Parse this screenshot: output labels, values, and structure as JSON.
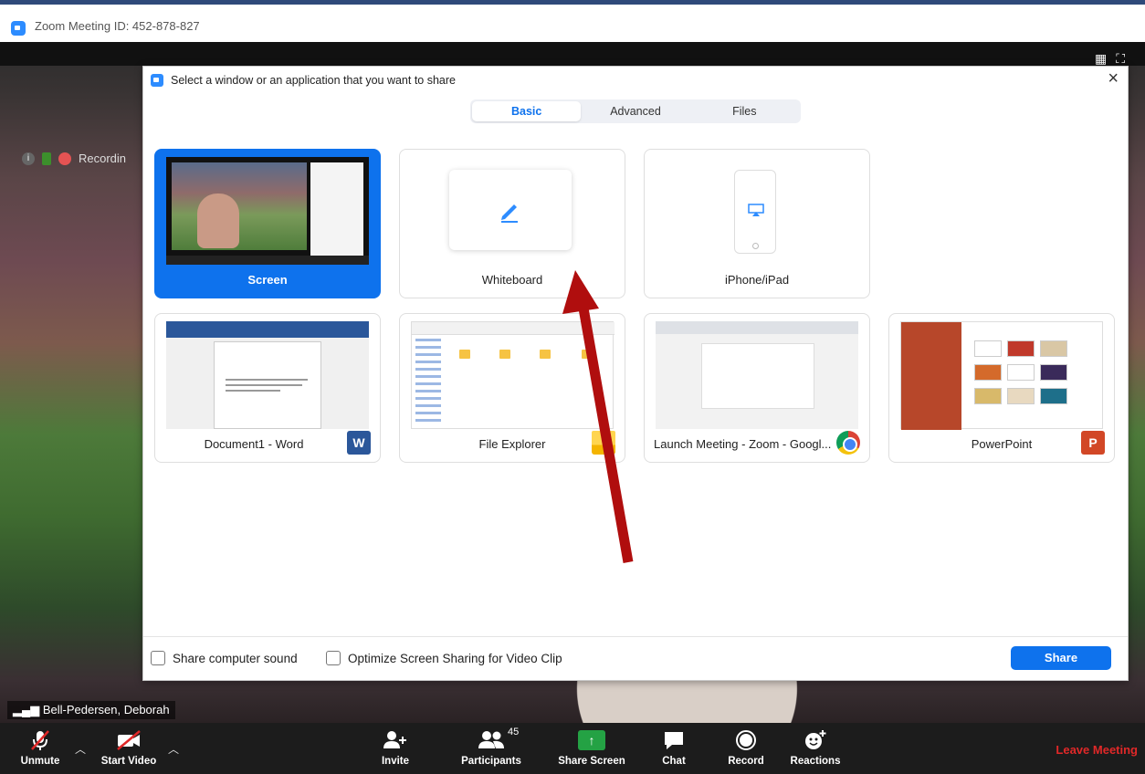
{
  "window": {
    "title": "Zoom Meeting ID: 452-878-827"
  },
  "video": {
    "recording_label": "Recordin",
    "speaker_name": "Bell-Pedersen, Deborah"
  },
  "dialog": {
    "title": "Select a window or an application that you want to share",
    "close_label": "×",
    "tabs": [
      "Basic",
      "Advanced",
      "Files"
    ],
    "active_tab": "Basic",
    "tiles": [
      {
        "label": "Screen",
        "selected": true
      },
      {
        "label": "Whiteboard"
      },
      {
        "label": "iPhone/iPad"
      },
      {
        "label": "Document1 - Word",
        "icon": "word-icon"
      },
      {
        "label": "File Explorer",
        "icon": "folder-icon"
      },
      {
        "label": "Launch Meeting - Zoom - Googl...",
        "icon": "chrome-icon"
      },
      {
        "label": "PowerPoint",
        "icon": "powerpoint-icon"
      }
    ],
    "options": {
      "sound": "Share computer sound",
      "optimize": "Optimize Screen Sharing for Video Clip"
    },
    "share_label": "Share"
  },
  "toolbar": {
    "unmute": "Unmute",
    "start_video": "Start Video",
    "invite": "Invite",
    "participants": "Participants",
    "participants_count": "45",
    "share_screen": "Share Screen",
    "chat": "Chat",
    "record": "Record",
    "reactions": "Reactions",
    "leave": "Leave Meeting"
  },
  "colors": {
    "accent": "#0e72ed",
    "share_green": "#24a244",
    "leave_red": "#e02828",
    "annotation_arrow": "#b00e0e"
  }
}
